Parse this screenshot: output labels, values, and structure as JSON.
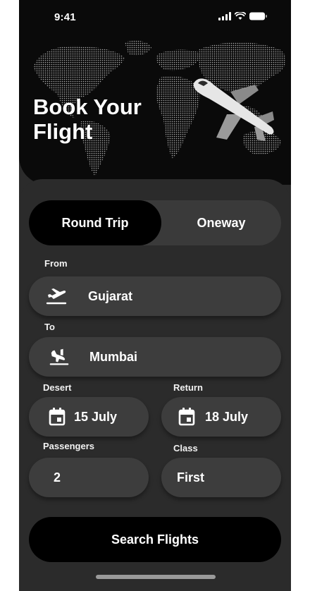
{
  "status": {
    "time": "9:41"
  },
  "hero": {
    "title_line1": "Book Your",
    "title_line2": "Flight"
  },
  "trip_toggle": {
    "round_trip": "Round Trip",
    "oneway": "Oneway",
    "selected": "Round Trip"
  },
  "form": {
    "from_label": "From",
    "from_value": "Gujarat",
    "to_label": "To",
    "to_value": "Mumbai",
    "depart_label": "Desert",
    "depart_value": "15 July",
    "return_label": "Return",
    "return_value": "18 July",
    "passengers_label": "Passengers",
    "passengers_value": "2",
    "class_label": "Class",
    "class_value": "First"
  },
  "search_button": "Search Flights"
}
